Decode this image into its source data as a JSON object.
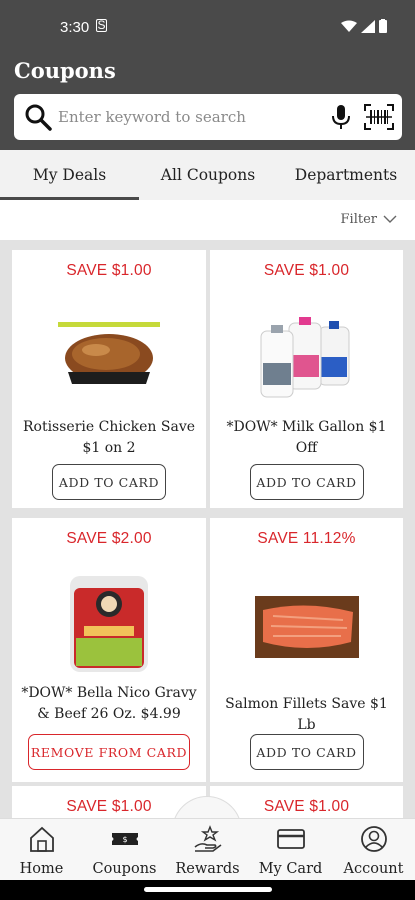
{
  "status": {
    "time": "3:30",
    "sim": "S"
  },
  "header": {
    "title": "Coupons"
  },
  "search": {
    "placeholder": "Enter keyword to search"
  },
  "tabs": [
    {
      "label": "My Deals",
      "active": true
    },
    {
      "label": "All Coupons",
      "active": false
    },
    {
      "label": "Departments",
      "active": false
    }
  ],
  "filter": {
    "label": "Filter"
  },
  "coupons": [
    {
      "save": "SAVE $1.00",
      "name": "Rotisserie Chicken Save $1 on 2",
      "button": "ADD TO CARD",
      "image": "rotisserie-chicken"
    },
    {
      "save": "SAVE $1.00",
      "name": "*DOW* Milk Gallon $1 Off",
      "button": "ADD TO CARD",
      "image": "milk-gallons"
    },
    {
      "save": "SAVE $2.00",
      "name": "*DOW* Bella Nico Gravy & Beef 26 Oz. $4.99",
      "button": "REMOVE FROM CARD",
      "image": "gravy-beef-tub"
    },
    {
      "save": "SAVE 11.12%",
      "name": "Salmon Fillets Save $1 Lb",
      "button": "ADD TO CARD",
      "image": "salmon-fillet"
    },
    {
      "save": "SAVE $1.00"
    },
    {
      "save": "SAVE $1.00"
    }
  ],
  "bottom_nav": [
    {
      "label": "Home",
      "icon": "home-icon"
    },
    {
      "label": "Coupons",
      "icon": "coupon-icon"
    },
    {
      "label": "Rewards",
      "icon": "rewards-icon"
    },
    {
      "label": "My Card",
      "icon": "card-icon"
    },
    {
      "label": "Account",
      "icon": "account-icon"
    }
  ],
  "colors": {
    "header": "#4a4a4a",
    "accent": "#d9262b",
    "grid_bg": "#e2e2e2"
  }
}
